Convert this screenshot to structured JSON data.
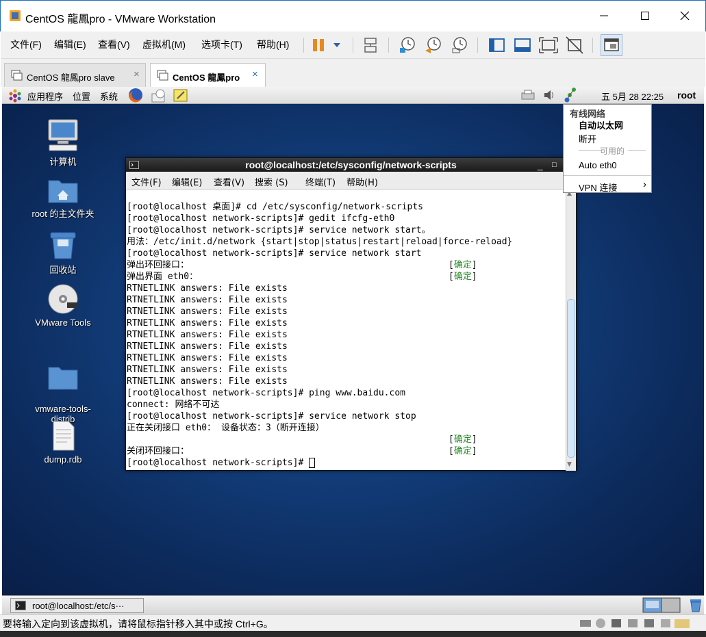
{
  "window": {
    "title": "CentOS 龍鳳pro - VMware Workstation"
  },
  "menu": [
    "文件(F)",
    "编辑(E)",
    "查看(V)",
    "虚拟机(M)",
    "选项卡(T)",
    "帮助(H)"
  ],
  "tabs": [
    {
      "label": "CentOS 龍鳳pro slave",
      "active": false
    },
    {
      "label": "CentOS 龍鳳pro",
      "active": true
    }
  ],
  "guest_panel": {
    "items": [
      "应用程序",
      "位置",
      "系统"
    ],
    "clock": "五 5月 28 22:25",
    "user": "root"
  },
  "desktop_icons": [
    {
      "label": "计算机"
    },
    {
      "label": "root 的主文件夹"
    },
    {
      "label": "回收站"
    },
    {
      "label": "VMware Tools"
    },
    {
      "label": "vmware-tools-\ndistrib"
    },
    {
      "label": "dump.rdb"
    }
  ],
  "terminal": {
    "title": "root@localhost:/etc/sysconfig/network-scripts",
    "menu": [
      "文件(F)",
      "编辑(E)",
      "查看(V)",
      "搜索 (S)",
      "终端(T)",
      "帮助(H)"
    ],
    "lines": [
      {
        "text": "[root@localhost 桌面]# cd /etc/sysconfig/network-scripts"
      },
      {
        "text": "[root@localhost network-scripts]# gedit ifcfg-eth0"
      },
      {
        "text": "[root@localhost network-scripts]# service network start。"
      },
      {
        "text": "用法：/etc/init.d/network {start|stop|status|restart|reload|force-reload}"
      },
      {
        "text": "[root@localhost network-scripts]# service network start"
      },
      {
        "text": "弹出环回接口：",
        "status": "确定"
      },
      {
        "text": "弹出界面 eth0：",
        "status": "确定"
      },
      {
        "text": "RTNETLINK answers: File exists"
      },
      {
        "text": "RTNETLINK answers: File exists"
      },
      {
        "text": "RTNETLINK answers: File exists"
      },
      {
        "text": "RTNETLINK answers: File exists"
      },
      {
        "text": "RTNETLINK answers: File exists"
      },
      {
        "text": "RTNETLINK answers: File exists"
      },
      {
        "text": "RTNETLINK answers: File exists"
      },
      {
        "text": "RTNETLINK answers: File exists"
      },
      {
        "text": "RTNETLINK answers: File exists"
      },
      {
        "text": "[root@localhost network-scripts]# ping www.baidu.com"
      },
      {
        "text": "connect: 网络不可达"
      },
      {
        "text": "[root@localhost network-scripts]# service network stop"
      },
      {
        "text": "正在关闭接口 eth0： 设备状态：3（断开连接）"
      },
      {
        "text": "",
        "status": "确定"
      },
      {
        "text": "关闭环回接口：",
        "status": "确定"
      },
      {
        "text": "[root@localhost network-scripts]# ",
        "cursor": true
      }
    ]
  },
  "network_menu": {
    "header": "有线网络",
    "active": "自动以太网",
    "disconnect": "断开",
    "available_label": "可用的",
    "item": "Auto eth0",
    "vpn": "VPN 连接"
  },
  "taskbar": {
    "window_button": "root@localhost:/etc/s···"
  },
  "statusbar": {
    "message": "要将输入定向到该虚拟机，请将鼠标指针移入其中或按 Ctrl+G。"
  },
  "colors": {
    "desktop_bg": "#133f7d",
    "ok_green": "#2a8a2a",
    "accent": "#1e6fbf"
  }
}
